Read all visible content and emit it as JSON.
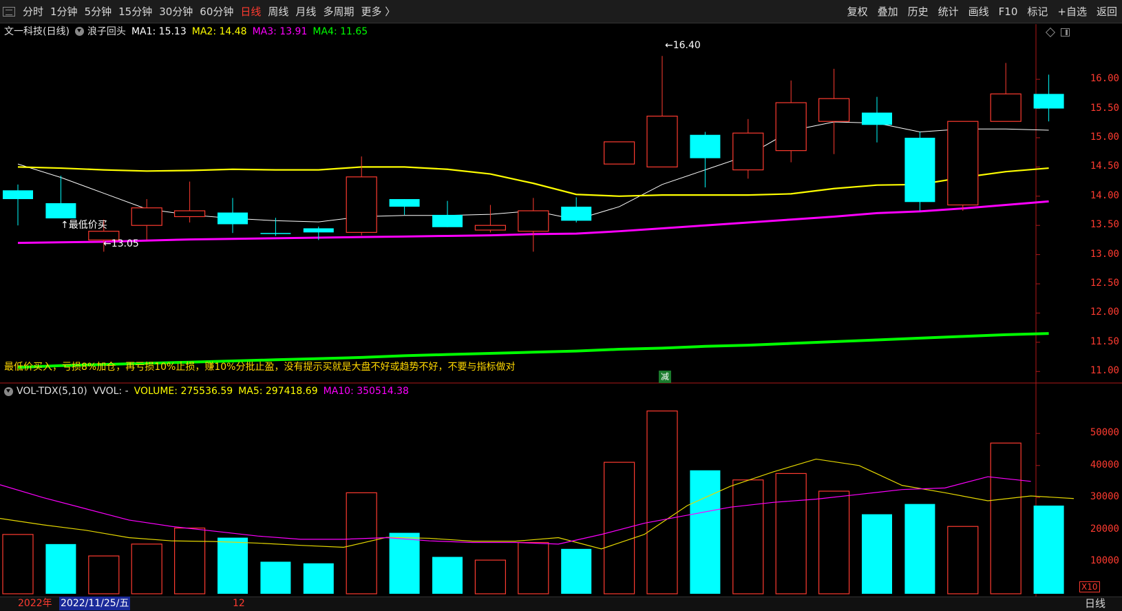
{
  "topbar": {
    "left_tabs": [
      "分时",
      "1分钟",
      "5分钟",
      "15分钟",
      "30分钟",
      "60分钟",
      "日线",
      "周线",
      "月线",
      "多周期",
      "更多 〉"
    ],
    "active_tab": "日线",
    "right_tabs": [
      "复权",
      "叠加",
      "历史",
      "统计",
      "画线",
      "F10",
      "标记",
      "+自选",
      "返回"
    ]
  },
  "price_panel": {
    "stock": "文一科技(日线)",
    "indicator": "浪子回头",
    "ma1": "MA1: 15.13",
    "ma2": "MA2: 14.48",
    "ma3": "MA3: 13.91",
    "ma4": "MA4: 11.65",
    "note": "最低价买入，亏损8%加仓，再亏损10%止损，赚10%分批止盈，没有提示买就是大盘不好或趋势不好，不要与指标做对",
    "reduce_badge": "减",
    "low_label": "↑最低价买",
    "low_price": "←13.05",
    "high_price": "←16.40"
  },
  "volume_panel": {
    "indicator": "VOL-TDX(5,10)",
    "vvol": "VVOL: -",
    "volume": "VOLUME: 275536.59",
    "ma5": "MA5: 297418.69",
    "ma10": "MA10: 350514.38",
    "scale_badge": "X10"
  },
  "x_axis": {
    "year": "2022年",
    "cursor_date": "2022/11/25/五",
    "month": "12"
  },
  "footer": {
    "period": "日线"
  },
  "colors": {
    "up": "#ff3b30",
    "down": "#00ffff",
    "ma1": "#ffffff",
    "ma2": "#ffff00",
    "ma3": "#ff00ff",
    "ma4": "#00ff00",
    "background": "#000000"
  },
  "icons": [
    "menu-icon",
    "diamond-icon",
    "panel-toggle-icon",
    "dropdown-circle-icon"
  ],
  "chart_data": [
    {
      "type": "candlestick",
      "title": "文一科技(日线)",
      "y_ticks": [
        "16.00",
        "15.50",
        "15.00",
        "14.50",
        "14.00",
        "13.50",
        "13.00",
        "12.50",
        "12.00",
        "11.50",
        "11.00"
      ],
      "ylim": [
        10.85,
        16.65
      ],
      "candles": [
        {
          "o": 14.1,
          "c": 13.95,
          "h": 14.2,
          "l": 13.5,
          "up": false
        },
        {
          "o": 13.88,
          "c": 13.62,
          "h": 14.35,
          "l": 13.62,
          "up": false
        },
        {
          "o": 13.25,
          "c": 13.4,
          "h": 13.6,
          "l": 13.05,
          "up": true
        },
        {
          "o": 13.5,
          "c": 13.8,
          "h": 13.95,
          "l": 13.25,
          "up": true
        },
        {
          "o": 13.65,
          "c": 13.75,
          "h": 14.25,
          "l": 13.55,
          "up": true
        },
        {
          "o": 13.72,
          "c": 13.52,
          "h": 13.97,
          "l": 13.37,
          "up": false
        },
        {
          "o": 13.37,
          "c": 13.36,
          "h": 13.63,
          "l": 13.32,
          "up": false
        },
        {
          "o": 13.45,
          "c": 13.38,
          "h": 13.48,
          "l": 13.25,
          "up": false
        },
        {
          "o": 13.38,
          "c": 14.33,
          "h": 14.68,
          "l": 13.33,
          "up": true
        },
        {
          "o": 13.95,
          "c": 13.82,
          "h": 13.95,
          "l": 13.68,
          "up": false
        },
        {
          "o": 13.68,
          "c": 13.47,
          "h": 13.92,
          "l": 13.47,
          "up": false
        },
        {
          "o": 13.42,
          "c": 13.5,
          "h": 13.85,
          "l": 13.38,
          "up": true
        },
        {
          "o": 13.4,
          "c": 13.75,
          "h": 13.97,
          "l": 13.05,
          "up": true
        },
        {
          "o": 13.82,
          "c": 13.58,
          "h": 13.98,
          "l": 13.55,
          "up": false
        },
        {
          "o": 14.55,
          "c": 14.93,
          "h": 14.93,
          "l": 14.55,
          "up": true
        },
        {
          "o": 14.5,
          "c": 15.37,
          "h": 16.4,
          "l": 14.5,
          "up": true
        },
        {
          "o": 15.05,
          "c": 14.65,
          "h": 15.1,
          "l": 14.15,
          "up": false
        },
        {
          "o": 14.45,
          "c": 15.08,
          "h": 15.32,
          "l": 14.3,
          "up": true
        },
        {
          "o": 14.78,
          "c": 15.6,
          "h": 15.98,
          "l": 14.58,
          "up": true
        },
        {
          "o": 15.28,
          "c": 15.67,
          "h": 16.18,
          "l": 14.72,
          "up": true
        },
        {
          "o": 15.43,
          "c": 15.22,
          "h": 15.7,
          "l": 14.92,
          "up": false
        },
        {
          "o": 15.0,
          "c": 13.9,
          "h": 15.1,
          "l": 13.75,
          "up": false
        },
        {
          "o": 13.85,
          "c": 15.28,
          "h": 15.28,
          "l": 13.75,
          "up": true
        },
        {
          "o": 15.28,
          "c": 15.75,
          "h": 16.28,
          "l": 15.28,
          "up": true
        },
        {
          "o": 15.75,
          "c": 15.5,
          "h": 16.08,
          "l": 15.28,
          "up": false
        }
      ],
      "series": [
        {
          "name": "MA1",
          "values": [
            14.55,
            14.32,
            14.05,
            13.78,
            13.68,
            13.62,
            13.58,
            13.56,
            13.65,
            13.67,
            13.67,
            13.69,
            13.75,
            13.6,
            13.82,
            14.2,
            14.45,
            14.7,
            15.12,
            15.27,
            15.25,
            15.1,
            15.15,
            15.15,
            15.13
          ]
        },
        {
          "name": "MA2",
          "values": [
            14.5,
            14.48,
            14.45,
            14.43,
            14.44,
            14.46,
            14.45,
            14.45,
            14.5,
            14.5,
            14.46,
            14.38,
            14.22,
            14.03,
            14.0,
            14.02,
            14.02,
            14.02,
            14.04,
            14.13,
            14.19,
            14.2,
            14.32,
            14.42,
            14.48
          ]
        },
        {
          "name": "MA3",
          "values": [
            13.2,
            13.21,
            13.22,
            13.24,
            13.26,
            13.27,
            13.28,
            13.29,
            13.3,
            13.31,
            13.32,
            13.33,
            13.35,
            13.36,
            13.4,
            13.45,
            13.5,
            13.55,
            13.6,
            13.65,
            13.71,
            13.74,
            13.79,
            13.85,
            13.91
          ]
        },
        {
          "name": "MA4",
          "values": [
            11.07,
            11.1,
            11.12,
            11.14,
            11.16,
            11.18,
            11.2,
            11.22,
            11.24,
            11.27,
            11.29,
            11.31,
            11.33,
            11.35,
            11.38,
            11.4,
            11.43,
            11.45,
            11.48,
            11.51,
            11.54,
            11.57,
            11.6,
            11.63,
            11.65
          ]
        }
      ]
    },
    {
      "type": "bar",
      "title": "VOL-TDX(5,10)",
      "y_ticks": [
        "50000",
        "40000",
        "30000",
        "20000",
        "10000"
      ],
      "ylim": [
        0,
        61000
      ],
      "values": [
        18500,
        15500,
        11800,
        15500,
        20500,
        17500,
        10000,
        9500,
        31500,
        19000,
        11500,
        10500,
        16000,
        14000,
        41000,
        57000,
        38500,
        35500,
        37500,
        32000,
        24800,
        28000,
        21000,
        47000,
        27500
      ],
      "up": [
        true,
        false,
        true,
        true,
        true,
        false,
        false,
        false,
        true,
        false,
        false,
        true,
        true,
        false,
        true,
        true,
        false,
        true,
        true,
        true,
        false,
        false,
        true,
        true,
        false
      ],
      "series": [
        {
          "name": "MA5",
          "values": [
            23500,
            21500,
            19800,
            17500,
            16500,
            16300,
            15800,
            15100,
            14500,
            17600,
            17300,
            16400,
            16400,
            17500,
            14000,
            18500,
            27500,
            33500,
            38000,
            42000,
            40000,
            33800,
            31500,
            29000,
            30500,
            29700
          ]
        },
        {
          "name": "MA10",
          "values": [
            34000,
            30000,
            26500,
            23000,
            21000,
            19500,
            18000,
            17000,
            17000,
            17500,
            16500,
            16000,
            16000,
            15500,
            18500,
            22000,
            24500,
            27000,
            28500,
            29500,
            31000,
            32500,
            33000,
            36500,
            35051
          ]
        }
      ]
    }
  ]
}
